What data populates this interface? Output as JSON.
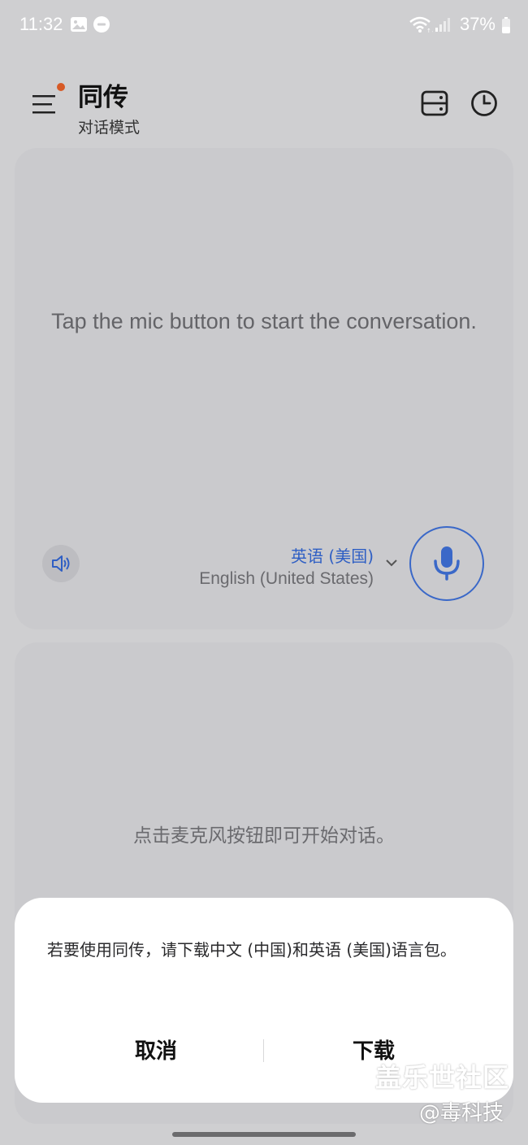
{
  "status_bar": {
    "time": "11:32",
    "battery": "37%",
    "icons": [
      "gallery-icon",
      "dnd-icon",
      "wifi-icon",
      "signal-icon",
      "battery-icon"
    ]
  },
  "header": {
    "title": "同传",
    "subtitle": "对话模式",
    "menu_icon": "menu-icon",
    "notification_dot_color": "#d75a26",
    "actions": [
      "split-screen-icon",
      "history-icon"
    ]
  },
  "top_panel": {
    "prompt": "Tap the mic button to start the conversation.",
    "language_native": "英语 (美国)",
    "language_english": "English (United States)",
    "speaker_icon": "speaker-icon",
    "mic_icon": "mic-icon",
    "accent_color": "#3a68c8"
  },
  "bottom_panel": {
    "prompt": "点击麦克风按钮即可开始对话。"
  },
  "dialog": {
    "message": "若要使用同传，请下载中文 (中国)和英语 (美国)语言包。",
    "cancel_label": "取消",
    "download_label": "下载"
  },
  "watermark": {
    "line1": "盖乐世社区",
    "line2": "@毒科技"
  }
}
